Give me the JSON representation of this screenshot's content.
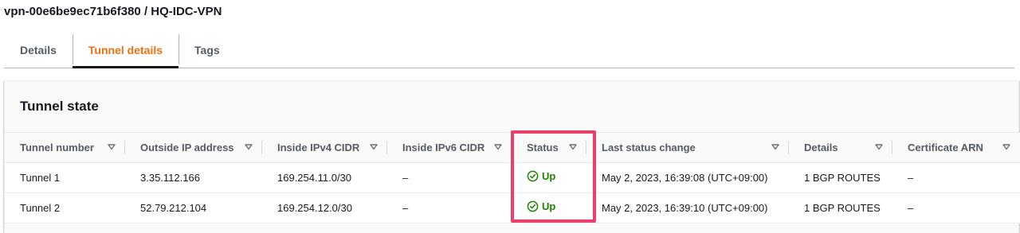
{
  "page": {
    "title": "vpn-00e6be9ec71b6f380 / HQ-IDC-VPN"
  },
  "tabs": [
    {
      "label": "Details",
      "active": false
    },
    {
      "label": "Tunnel details",
      "active": true
    },
    {
      "label": "Tags",
      "active": false
    }
  ],
  "tunnel_state": {
    "title": "Tunnel state",
    "columns": [
      "Tunnel number",
      "Outside IP address",
      "Inside IPv4 CIDR",
      "Inside IPv6 CIDR",
      "Status",
      "Last status change",
      "Details",
      "Certificate ARN"
    ],
    "rows": [
      {
        "tunnel": "Tunnel 1",
        "outside_ip": "3.35.112.166",
        "ipv4": "169.254.11.0/30",
        "ipv6": "–",
        "status": "Up",
        "last_change": "May 2, 2023, 16:39:08 (UTC+09:00)",
        "details": "1 BGP ROUTES",
        "cert": "–"
      },
      {
        "tunnel": "Tunnel 2",
        "outside_ip": "52.79.212.104",
        "ipv4": "169.254.12.0/30",
        "ipv6": "–",
        "status": "Up",
        "last_change": "May 2, 2023, 16:39:10 (UTC+09:00)",
        "details": "1 BGP ROUTES",
        "cert": "–"
      }
    ]
  },
  "colors": {
    "active_tab": "#ec7211",
    "status_up": "#1d8102",
    "highlight": "#ec3f6c"
  },
  "icons": {
    "sort": "sort-caret-down-icon",
    "status": "check-circle-icon"
  }
}
